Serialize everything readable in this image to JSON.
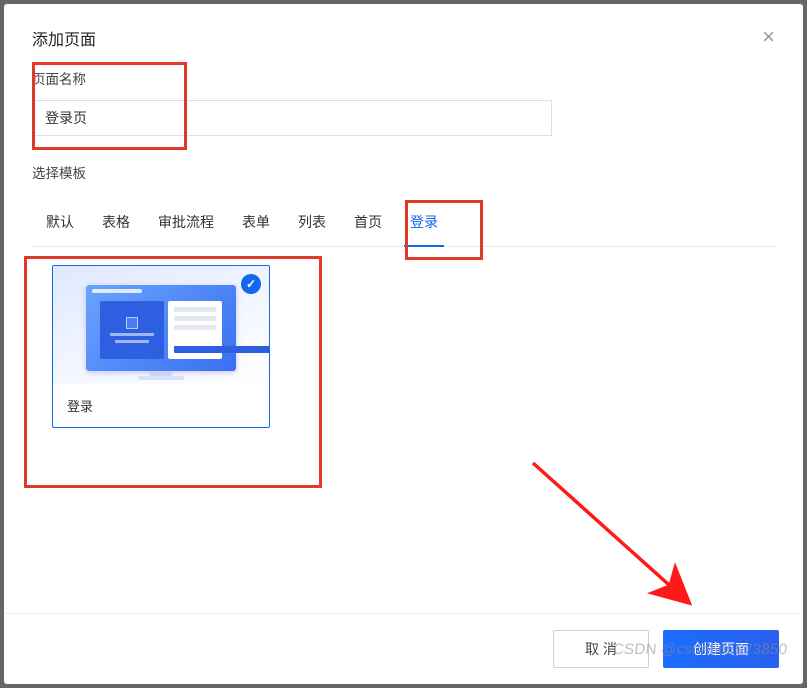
{
  "modal": {
    "title": "添加页面",
    "close_glyph": "×"
  },
  "form": {
    "name_label": "页面名称",
    "name_value": "登录页",
    "template_label": "选择模板"
  },
  "tabs": [
    {
      "id": "default",
      "label": "默认"
    },
    {
      "id": "table",
      "label": "表格"
    },
    {
      "id": "approval",
      "label": "审批流程"
    },
    {
      "id": "form",
      "label": "表单"
    },
    {
      "id": "list",
      "label": "列表"
    },
    {
      "id": "home",
      "label": "首页"
    },
    {
      "id": "login",
      "label": "登录",
      "active": true
    }
  ],
  "templates": {
    "login": {
      "card_label": "登录",
      "selected": true,
      "check_glyph": "✓"
    }
  },
  "footer": {
    "cancel": "取 消",
    "confirm": "创建页面"
  },
  "watermark": "CSDN @csdn565973850"
}
